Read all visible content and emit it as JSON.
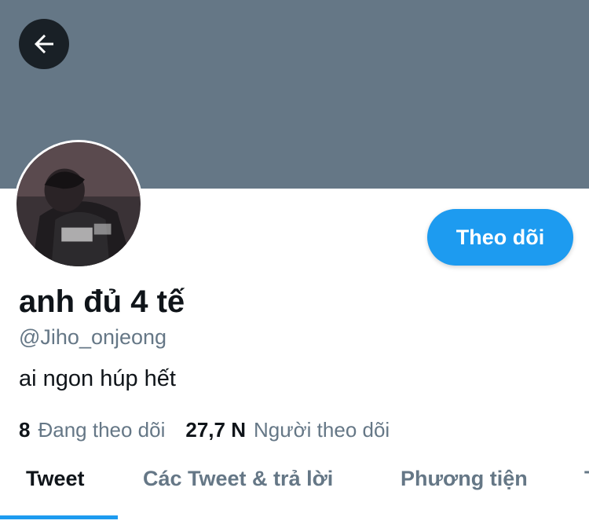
{
  "header": {
    "back_icon": "arrow-left-icon",
    "banner_color": "#657786"
  },
  "profile": {
    "display_name": "anh đủ 4 tế",
    "handle": "@Jiho_onjeong",
    "bio": "ai ngon húp hết",
    "follow_button": "Theo dõi"
  },
  "stats": {
    "following_count": "8",
    "following_label": "Đang theo dõi",
    "followers_count": "27,7 N",
    "followers_label": "Người theo dõi"
  },
  "tabs": [
    {
      "label": "Tweet",
      "active": true
    },
    {
      "label": "Các Tweet & trả lời",
      "active": false
    },
    {
      "label": "Phương tiện",
      "active": false
    },
    {
      "label": "Thích",
      "active": false
    }
  ],
  "colors": {
    "accent": "#1d9bf0",
    "secondary_text": "#657786"
  }
}
